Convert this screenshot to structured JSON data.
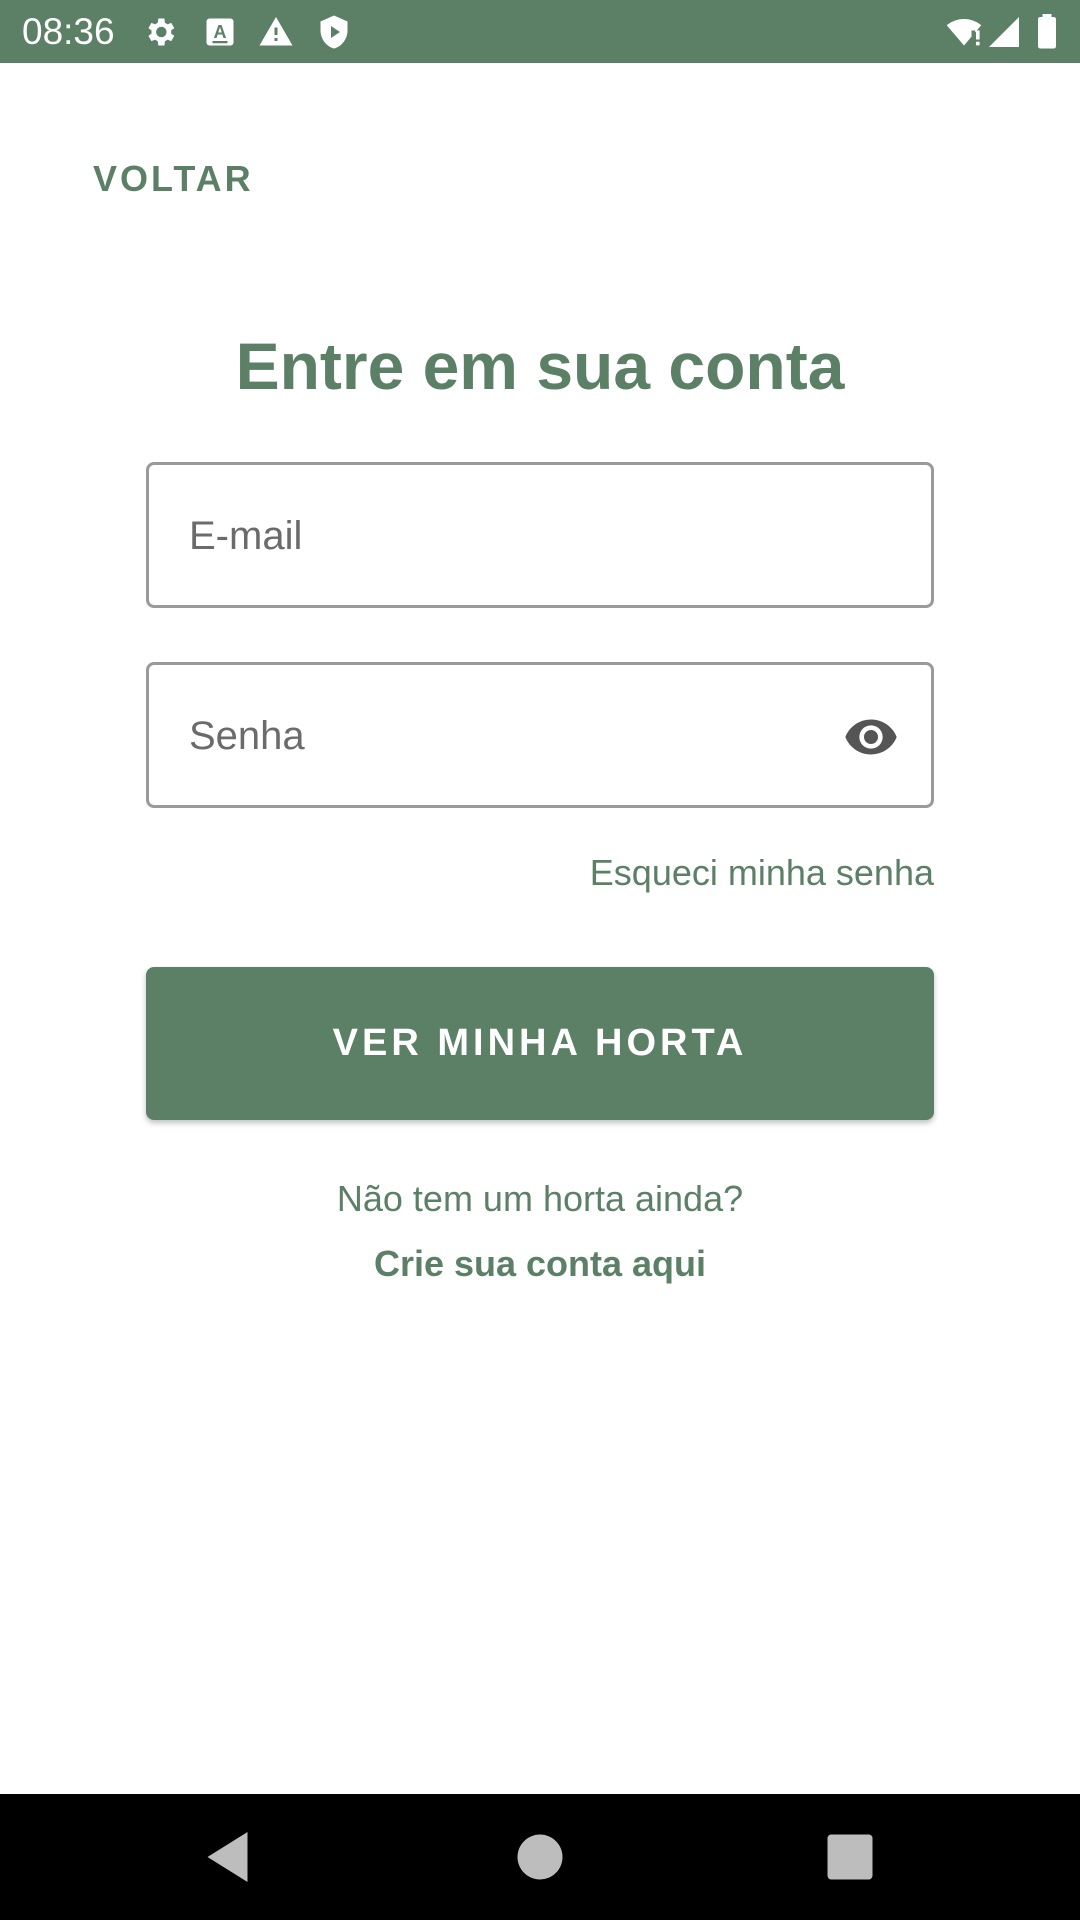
{
  "status_bar": {
    "time": "08:36",
    "left_icons": [
      "gear-icon",
      "keyboard-a-icon",
      "warning-icon",
      "shield-play-icon"
    ],
    "right_icons": [
      "wifi-alert-icon",
      "signal-icon",
      "battery-icon"
    ]
  },
  "header": {
    "back_label": "VOLTAR"
  },
  "login": {
    "title": "Entre em sua conta",
    "email": {
      "placeholder": "E-mail",
      "value": ""
    },
    "password": {
      "placeholder": "Senha",
      "value": ""
    },
    "forgot_label": "Esqueci minha senha",
    "submit_label": "VER MINHA HORTA",
    "signup_prompt": "Não tem um horta ainda?",
    "signup_link": "Crie sua conta aqui"
  },
  "nav_bar": {
    "buttons": [
      "back-triangle-icon",
      "home-circle-icon",
      "recents-square-icon"
    ]
  },
  "colors": {
    "brand": "#5c8066",
    "background": "#ffffff",
    "field_border": "#9a9a9a",
    "nav_bar": "#000000"
  }
}
